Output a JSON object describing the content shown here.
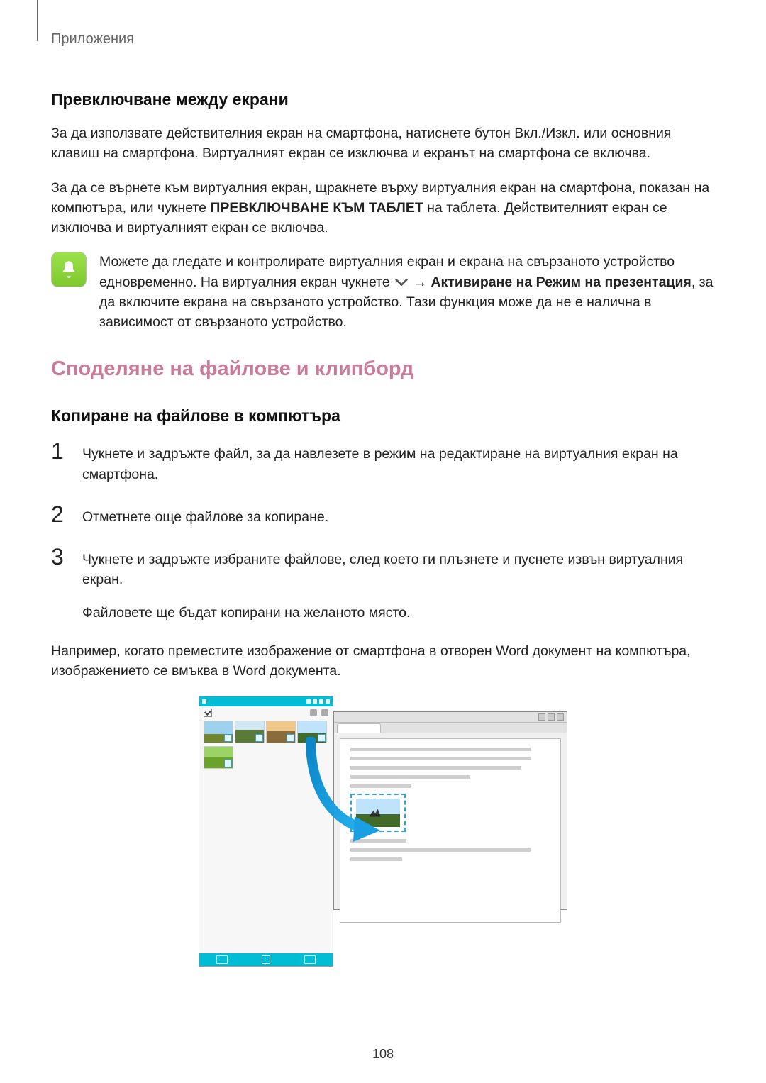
{
  "header": {
    "section_label": "Приложения"
  },
  "section1": {
    "heading": "Превключване между екрани",
    "para1": "За да използвате действителния екран на смартфона, натиснете бутон Вкл./Изкл. или основния клавиш на смартфона. Виртуалният екран се изключва и екранът на смартфона се включва.",
    "para2_a": "За да се върнете към виртуалния екран, щракнете върху виртуалния екран на смартфона, показан на компютъра, или чукнете ",
    "para2_bold": "ПРЕВКЛЮЧВАНЕ КЪМ ТАБЛЕТ",
    "para2_b": " на таблета. Действителният екран се изключва и виртуалният екран се включва.",
    "note_a": "Можете да гледате и контролирате виртуалния екран и екрана на свързаното устройство едновременно. На виртуалния екран чукнете ",
    "note_arrow": " → ",
    "note_bold": "Активиране на Режим на презентация",
    "note_b": ", за да включите екрана на свързаното устройство. Тази функция може да не е налична в зависимост от свързаното устройство."
  },
  "section2": {
    "heading_main": "Споделяне на файлове и клипборд",
    "heading_sub": "Копиране на файлове в компютъра",
    "steps": {
      "n1": "1",
      "t1": "Чукнете и задръжте файл, за да навлезете в режим на редактиране на виртуалния екран на смартфона.",
      "n2": "2",
      "t2": "Отметнете още файлове за копиране.",
      "n3": "3",
      "t3a": "Чукнете и задръжте избраните файлове, след което ги плъзнете и пуснете извън виртуалния екран.",
      "t3b": "Файловете ще бъдат копирани на желаното място."
    },
    "para_after": "Например, когато преместите изображение от смартфона в отворен Word документ на компютъра, изображението се вмъква в Word документа."
  },
  "page_number": "108"
}
